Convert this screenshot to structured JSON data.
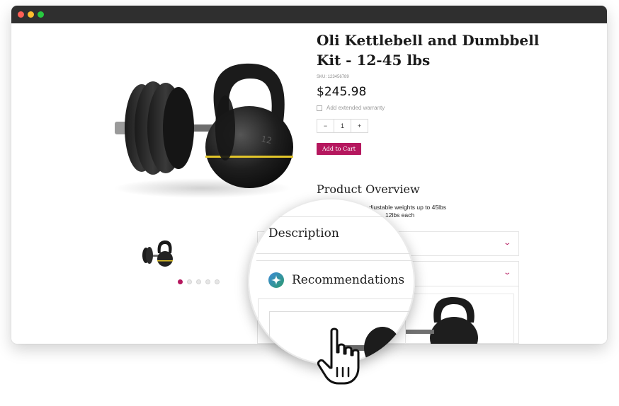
{
  "window": {
    "controls": [
      "close-dot",
      "minimize-dot",
      "maximize-dot"
    ]
  },
  "product": {
    "title": "Oli Kettlebell and Dumbbell Kit - 12-45 lbs",
    "sku": "SKU: 123456789",
    "price": "$245.98",
    "warranty_label": "Add extended warranty",
    "quantity": {
      "minus": "−",
      "value": "1",
      "plus": "+"
    },
    "add_to_cart_label": "Add to Cart",
    "kettlebell_label": "12"
  },
  "gallery": {
    "dots": 5,
    "active_dot": 0
  },
  "overview": {
    "heading": "Product Overview",
    "feature_1": "h adjustable weights up to 45lbs",
    "feature_2": "12lbs each"
  },
  "accordion": {
    "description_label": "Description",
    "recommendations_label": "Recommendations"
  },
  "colors": {
    "accent": "#b5175e",
    "titlebar": "#2f2f2f"
  },
  "icons": {
    "chevron": "chevron-down-icon",
    "ai": "sparkle-icon",
    "cursor": "hand-pointer-icon"
  }
}
